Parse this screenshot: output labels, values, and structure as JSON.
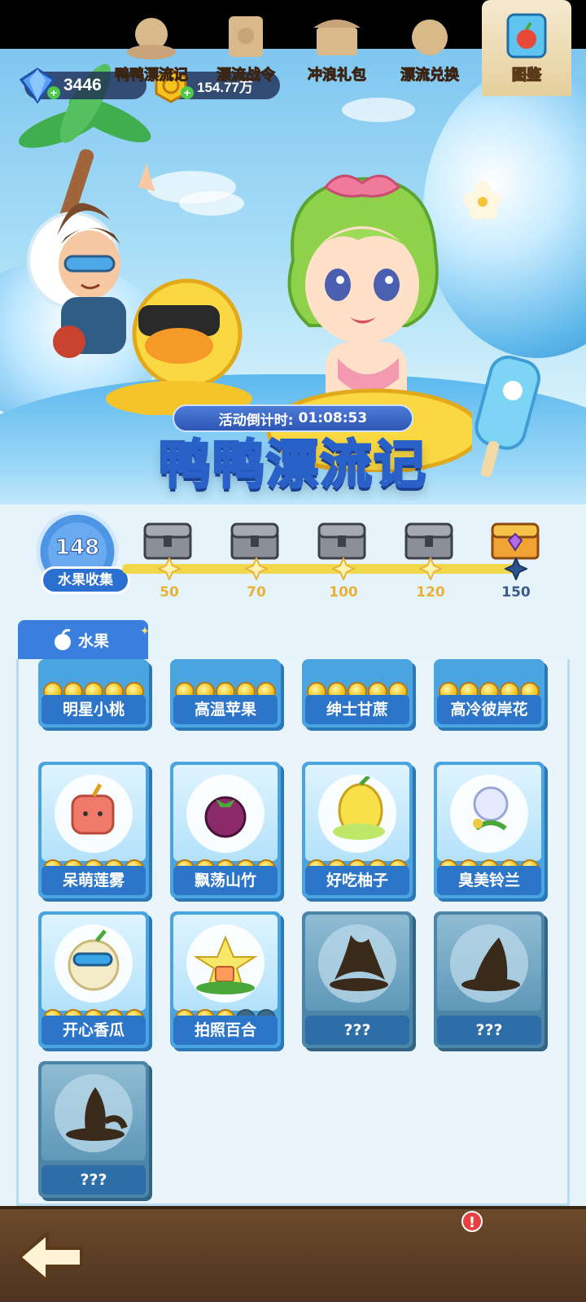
{
  "header": {
    "gems": "3446",
    "coins": "154.77万"
  },
  "event": {
    "countdown_label": "活动倒计时:",
    "countdown_value": "01:08:53",
    "title": "鸭鸭漂流记"
  },
  "collection_progress": {
    "current": "148",
    "label": "水果收集",
    "milestones": [
      {
        "value": "50",
        "reached": true
      },
      {
        "value": "70",
        "reached": true
      },
      {
        "value": "100",
        "reached": true
      },
      {
        "value": "120",
        "reached": true
      },
      {
        "value": "150",
        "reached": false
      }
    ]
  },
  "tab": {
    "label": "水果"
  },
  "cards": [
    {
      "name": "明星小桃",
      "stars": 5,
      "locked": false
    },
    {
      "name": "高温苹果",
      "stars": 5,
      "locked": false
    },
    {
      "name": "绅士甘蔗",
      "stars": 5,
      "locked": false
    },
    {
      "name": "高冷彼岸花",
      "stars": 5,
      "locked": false
    },
    {
      "name": "呆萌莲雾",
      "stars": 5,
      "locked": false
    },
    {
      "name": "飘荡山竹",
      "stars": 5,
      "locked": false
    },
    {
      "name": "好吃柚子",
      "stars": 5,
      "locked": false
    },
    {
      "name": "臭美铃兰",
      "stars": 5,
      "locked": false
    },
    {
      "name": "开心香瓜",
      "stars": 5,
      "locked": false
    },
    {
      "name": "拍照百合",
      "stars": 3,
      "locked": false
    },
    {
      "name": "???",
      "stars": 0,
      "locked": true
    },
    {
      "name": "???",
      "stars": 0,
      "locked": true
    },
    {
      "name": "???",
      "stars": 0,
      "locked": true
    }
  ],
  "bottom_nav": {
    "items": [
      {
        "label": "鸭鸭漂流记"
      },
      {
        "label": "漂流战令"
      },
      {
        "label": "冲浪礼包"
      },
      {
        "label": "漂流兑换"
      },
      {
        "label": "图鉴"
      }
    ],
    "badge": "!"
  },
  "colors": {
    "accent_blue": "#2c75c8",
    "gold": "#f3c21a",
    "nav_brown": "#5a3a20"
  }
}
